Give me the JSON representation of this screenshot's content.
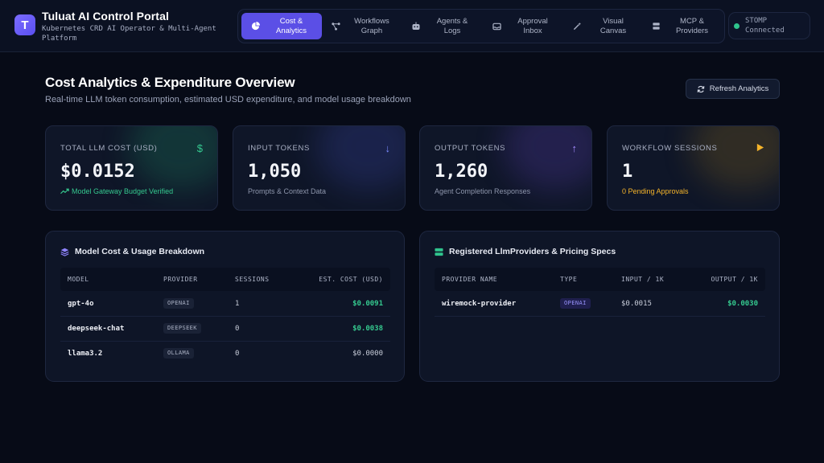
{
  "app": {
    "title": "Tuluat AI Control Portal",
    "subtitle": "Kubernetes CRD AI Operator & Multi-Agent Platform",
    "logo_letter": "T"
  },
  "nav": {
    "items": [
      {
        "label": "Cost & Analytics",
        "icon": "pie-chart-icon",
        "active": true
      },
      {
        "label": "Workflows Graph",
        "icon": "graph-icon",
        "active": false
      },
      {
        "label": "Agents & Logs",
        "icon": "robot-icon",
        "active": false
      },
      {
        "label": "Approval Inbox",
        "icon": "inbox-icon",
        "active": false
      },
      {
        "label": "Visual Canvas",
        "icon": "magic-wand-icon",
        "active": false
      },
      {
        "label": "MCP & Providers",
        "icon": "server-icon",
        "active": false
      }
    ]
  },
  "stomp": {
    "label": "STOMP",
    "status": "Connected",
    "color": "#2fc48d"
  },
  "page": {
    "title": "Cost Analytics & Expenditure Overview",
    "subtitle": "Real-time LLM token consumption, estimated USD expenditure, and model usage breakdown",
    "refresh_label": "Refresh Analytics"
  },
  "cards": [
    {
      "label": "TOTAL LLM COST (USD)",
      "value": "$0.0152",
      "foot": "Model Gateway Budget Verified",
      "icon": "dollar-icon",
      "accent": "#35c98f"
    },
    {
      "label": "INPUT TOKENS",
      "value": "1,050",
      "foot": "Prompts & Context Data",
      "icon": "arrow-down-icon",
      "accent": "#7c8cff"
    },
    {
      "label": "OUTPUT TOKENS",
      "value": "1,260",
      "foot": "Agent Completion Responses",
      "icon": "arrow-up-icon",
      "accent": "#a48cff"
    },
    {
      "label": "WORKFLOW SESSIONS",
      "value": "1",
      "foot": "0 Pending Approvals",
      "icon": "play-icon",
      "accent": "#f5b42a"
    }
  ],
  "models": {
    "title": "Model Cost & Usage Breakdown",
    "columns": [
      "MODEL",
      "PROVIDER",
      "SESSIONS",
      "EST. COST (USD)"
    ],
    "rows": [
      {
        "model": "gpt-4o",
        "provider": "OPENAI",
        "sessions": "1",
        "cost": "$0.0091"
      },
      {
        "model": "deepseek-chat",
        "provider": "DEEPSEEK",
        "sessions": "0",
        "cost": "$0.0038"
      },
      {
        "model": "llama3.2",
        "provider": "OLLAMA",
        "sessions": "0",
        "cost": "$0.0000"
      }
    ]
  },
  "providers": {
    "title": "Registered LlmProviders & Pricing Specs",
    "columns": [
      "PROVIDER NAME",
      "TYPE",
      "INPUT / 1K",
      "OUTPUT / 1K"
    ],
    "rows": [
      {
        "name": "wiremock-provider",
        "type": "OPENAI",
        "input": "$0.0015",
        "output": "$0.0030"
      }
    ]
  }
}
